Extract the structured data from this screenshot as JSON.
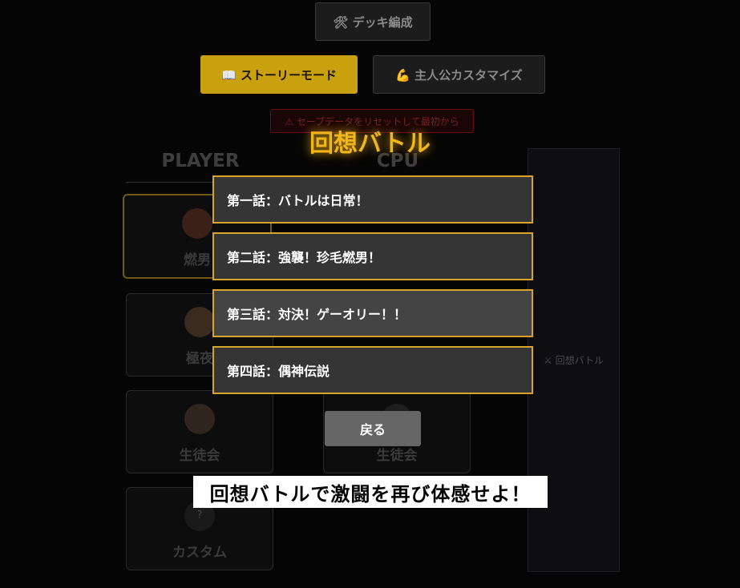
{
  "background": {
    "deck_button": "🛠 デッキ編成",
    "story_button": "📖 ストーリーモード",
    "customize_button": "💪 主人公カスタマイズ",
    "reset_button": "⚠ セーブデータをリセットして最初から",
    "player_header": "PLAYER",
    "cpu_header": "CPU",
    "player_cards": [
      "燃男",
      "極夜",
      "生徒会",
      "カスタム"
    ],
    "cpu_cards": [
      "",
      "",
      "",
      "生徒会"
    ],
    "custom_avatar_mark": "?",
    "side_panel_label": "⚔ 回想バトル"
  },
  "modal": {
    "title": "回想バトル",
    "episodes": [
      "第一話：バトルは日常！",
      "第二話：強襲！珍毛燃男！",
      "第三話：対決！ゲーオリー！！",
      "第四話：偶神伝説"
    ],
    "back_button": "戻る"
  },
  "caption": "回想バトルで激闘を再び体感せよ！",
  "colors": {
    "accent": "#f2b51a",
    "episode_border": "#d7a42c",
    "episode_bg": "#353535"
  }
}
